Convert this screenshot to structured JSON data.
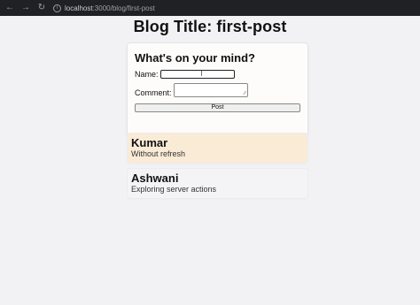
{
  "browser": {
    "url_host": "localhost",
    "url_rest": ":3000/blog/first-post"
  },
  "page": {
    "title": "Blog Title: first-post"
  },
  "form": {
    "heading": "What's on your mind?",
    "name_label": "Name:",
    "name_value": "",
    "comment_label": "Comment:",
    "comment_value": "",
    "submit_label": "Post"
  },
  "posts": [
    {
      "author": "Kumar",
      "text": "Without refresh"
    },
    {
      "author": "Ashwani",
      "text": "Exploring server actions"
    }
  ]
}
